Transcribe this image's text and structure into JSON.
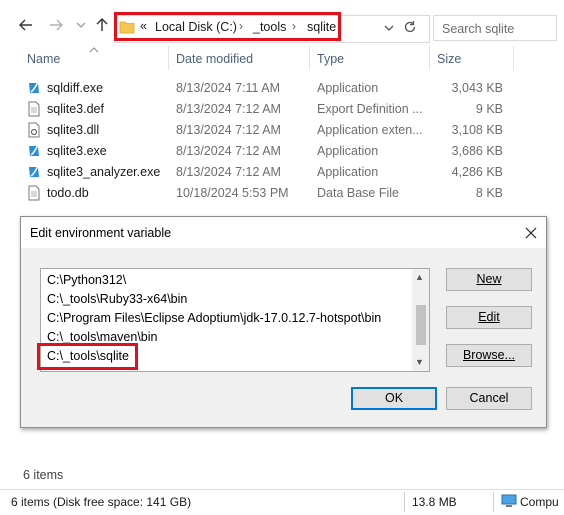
{
  "nav": {
    "back_icon": "arrow-left-icon",
    "forward_icon": "arrow-right-icon",
    "recent_icon": "chevron-down-icon",
    "up_icon": "arrow-up-icon"
  },
  "address_bar": {
    "overflow": "«",
    "crumbs": [
      "Local Disk (C:)",
      "_tools",
      "sqlite"
    ],
    "refresh_icon": "refresh-icon"
  },
  "search": {
    "placeholder": "Search sqlite"
  },
  "columns": {
    "name": "Name",
    "date": "Date modified",
    "type": "Type",
    "size": "Size"
  },
  "files": [
    {
      "name": "sqldiff.exe",
      "date": "8/13/2024 7:11 AM",
      "type": "Application",
      "size": "3,043 KB",
      "icon": "exe-icon"
    },
    {
      "name": "sqlite3.def",
      "date": "8/13/2024 7:12 AM",
      "type": "Export Definition ...",
      "size": "9 KB",
      "icon": "file-icon"
    },
    {
      "name": "sqlite3.dll",
      "date": "8/13/2024 7:12 AM",
      "type": "Application exten...",
      "size": "3,108 KB",
      "icon": "dll-icon"
    },
    {
      "name": "sqlite3.exe",
      "date": "8/13/2024 7:12 AM",
      "type": "Application",
      "size": "3,686 KB",
      "icon": "exe-icon"
    },
    {
      "name": "sqlite3_analyzer.exe",
      "date": "8/13/2024 7:12 AM",
      "type": "Application",
      "size": "4,286 KB",
      "icon": "exe-icon"
    },
    {
      "name": "todo.db",
      "date": "10/18/2024 5:53 PM",
      "type": "Data Base File",
      "size": "8 KB",
      "icon": "file-icon"
    }
  ],
  "item_count": "6 items",
  "statusbar": {
    "left": "6 items (Disk free space: 141 GB)",
    "size": "13.8 MB",
    "location": "Compu"
  },
  "dialog": {
    "title": "Edit environment variable",
    "paths": [
      "C:\\Python312\\",
      "C:\\_tools\\Ruby33-x64\\bin",
      "C:\\Program Files\\Eclipse Adoptium\\jdk-17.0.12.7-hotspot\\bin",
      "C:\\_tools\\maven\\bin",
      "C:\\_tools\\sqlite"
    ],
    "buttons": {
      "new": "New",
      "edit": "Edit",
      "browse": "Browse...",
      "ok": "OK",
      "cancel": "Cancel"
    }
  },
  "colors": {
    "highlight": "#e0101c",
    "accent": "#0078d7",
    "header_text": "#4c607a"
  }
}
